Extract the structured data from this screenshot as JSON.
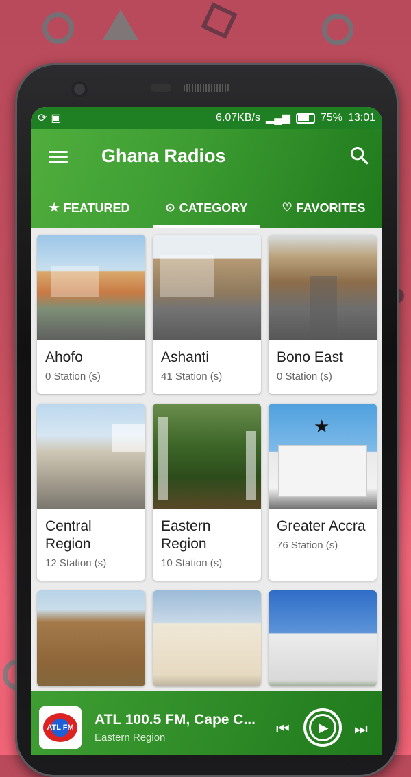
{
  "status_bar": {
    "net_speed": "6.07KB/s",
    "battery": "75%",
    "time": "13:01"
  },
  "app": {
    "title": "Ghana Radios"
  },
  "tabs": [
    {
      "icon": "★",
      "label": "FEATURED",
      "active": false
    },
    {
      "icon": "⊙",
      "label": "CATEGORY",
      "active": true
    },
    {
      "icon": "♡",
      "label": "FAVORITES",
      "active": false
    }
  ],
  "categories": [
    {
      "name": "Ahofo",
      "count": "0 Station (s)"
    },
    {
      "name": "Ashanti",
      "count": "41 Station (s)"
    },
    {
      "name": "Bono East",
      "count": "0 Station (s)"
    },
    {
      "name": "Central Region",
      "count": "12 Station (s)"
    },
    {
      "name": "Eastern Region",
      "count": "10 Station (s)"
    },
    {
      "name": "Greater Accra",
      "count": "76 Station (s)"
    }
  ],
  "player": {
    "station": "ATL 100.5 FM, Cape C...",
    "region": "Eastern Region",
    "logo_text": "ATL FM"
  },
  "colors": {
    "primary": "#3f9e33",
    "primary_dark": "#1f7f23",
    "background": "#ebebeb"
  }
}
